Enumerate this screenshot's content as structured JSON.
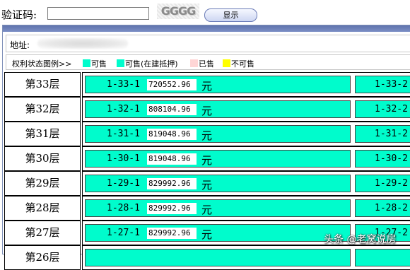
{
  "captcha": {
    "label": "验证码:",
    "input_value": "",
    "image_text": "GGGG",
    "button_label": "显示"
  },
  "address": {
    "label": "地址:"
  },
  "legend": {
    "title": "权利状态图例>>",
    "items": [
      {
        "label": "可售",
        "color": "#00fccc"
      },
      {
        "label": "可售(在建抵押)",
        "color": "#00fccc"
      },
      {
        "label": "已售",
        "color": "#ffd6d6"
      },
      {
        "label": "不可售",
        "color": "#ffff00"
      }
    ]
  },
  "floors": [
    {
      "name": "第33层",
      "unit": "1-33-1",
      "price": "720552.96",
      "unit2": "1-33-2"
    },
    {
      "name": "第32层",
      "unit": "1-32-1",
      "price": "808104.96",
      "unit2": "1-32-2"
    },
    {
      "name": "第31层",
      "unit": "1-31-1",
      "price": "819048.96",
      "unit2": "1-31-2"
    },
    {
      "name": "第30层",
      "unit": "1-30-1",
      "price": "819048.96",
      "unit2": "1-30-2"
    },
    {
      "name": "第29层",
      "unit": "1-29-1",
      "price": "829992.96",
      "unit2": "1-29-2"
    },
    {
      "name": "第28层",
      "unit": "1-28-1",
      "price": "829992.96",
      "unit2": "1-28-2"
    },
    {
      "name": "第27层",
      "unit": "1-27-1",
      "price": "829992.96",
      "unit2": "1-27-2"
    },
    {
      "name": "第26层",
      "unit": "",
      "price": "",
      "unit2": ""
    }
  ],
  "currency": "元",
  "watermark": "头条 @老窝说房"
}
